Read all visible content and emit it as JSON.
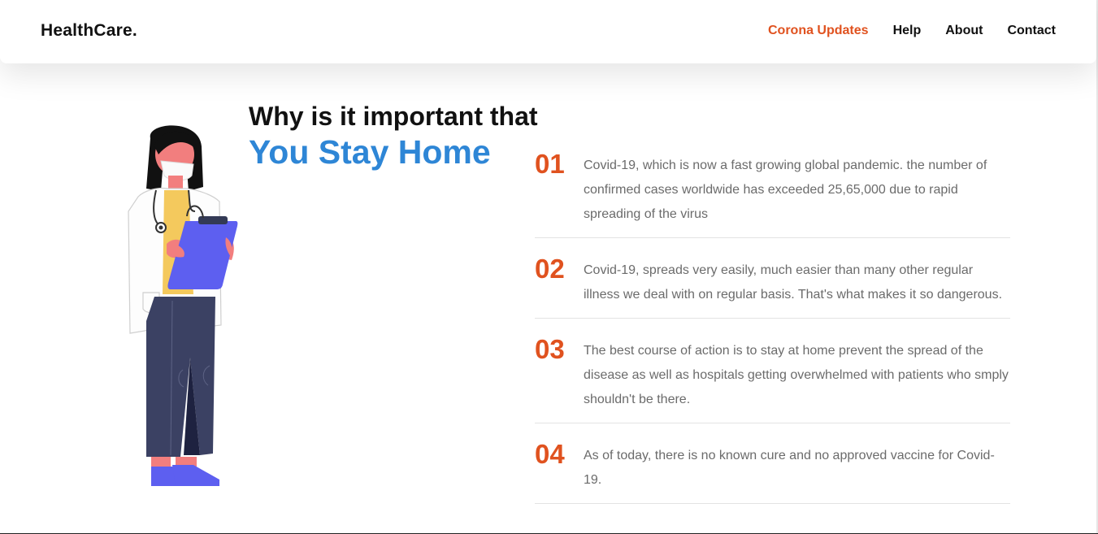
{
  "header": {
    "brand": "HealthCare.",
    "nav": [
      {
        "label": "Corona Updates",
        "active": true
      },
      {
        "label": "Help",
        "active": false
      },
      {
        "label": "About",
        "active": false
      },
      {
        "label": "Contact",
        "active": false
      }
    ]
  },
  "hero": {
    "heading_line1": "Why is it important that",
    "heading_line2": "You Stay Home"
  },
  "reasons": [
    {
      "number": "01",
      "text": "Covid-19, which is now a fast growing global pandemic. the number of confirmed cases worldwide has exceeded 25,65,000 due to rapid spreading of the virus"
    },
    {
      "number": "02",
      "text": "Covid-19, spreads very easily, much easier than many other regular illness we deal with on regular basis. That's what makes it so dangerous."
    },
    {
      "number": "03",
      "text": "The best course of action is to stay at home prevent the spread of the disease as well as hospitals getting overwhelmed with patients who smply shouldn't be there."
    },
    {
      "number": "04",
      "text": "As of today, there is no known cure and no approved vaccine for Covid-19."
    }
  ],
  "colors": {
    "accent": "#e0521f",
    "heading_blue": "#2e86d6",
    "text_gray": "#6b6b6b"
  },
  "illustration": {
    "icon": "doctor-with-clipboard-icon"
  }
}
